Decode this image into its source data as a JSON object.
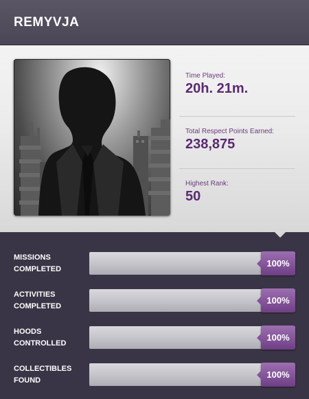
{
  "header": {
    "title": "REMYVJA"
  },
  "stats": {
    "time_played": {
      "label": "Time Played:",
      "value": "20h. 21m."
    },
    "respect": {
      "label": "Total Respect Points Earned:",
      "value": "238,875"
    },
    "rank": {
      "label": "Highest Rank:",
      "value": "50"
    }
  },
  "progress": [
    {
      "label": "MISSIONS COMPLETED",
      "value_text": "100%",
      "fraction": 1.0
    },
    {
      "label": "ACTIVITIES COMPLETED",
      "value_text": "100%",
      "fraction": 1.0
    },
    {
      "label": "HOODS CONTROLLED",
      "value_text": "100%",
      "fraction": 1.0
    },
    {
      "label": "COLLECTIBLES FOUND",
      "value_text": "100%",
      "fraction": 1.0
    }
  ],
  "colors": {
    "header_bg": "#4f4b5c",
    "panel_bg": "#3a3546",
    "accent_purple": "#7e4a95",
    "stat_value": "#5a2a70"
  },
  "icons": {
    "avatar": "silhouette-avatar-icon"
  }
}
